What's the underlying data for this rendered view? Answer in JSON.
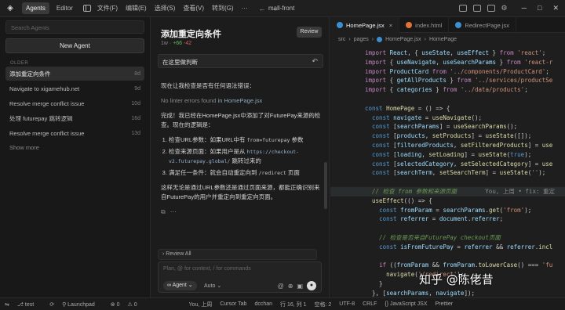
{
  "titlebar": {
    "tabs": [
      "Agents",
      "Editor"
    ],
    "menus": [
      "文件(F)",
      "编辑(E)",
      "选择(S)",
      "查看(V)",
      "转到(G)"
    ],
    "title": "mall-front"
  },
  "sidebar": {
    "search_placeholder": "Search Agents",
    "new_agent_label": "New Agent",
    "section_label": "OLDER",
    "items": [
      {
        "label": "添加重定向条件",
        "age": "8d"
      },
      {
        "label": "Navigate to xigamehub.net",
        "age": "9d"
      },
      {
        "label": "Resolve merge conflict issue",
        "age": "10d"
      },
      {
        "label": "处理 futurepay 跳转逻辑",
        "age": "16d"
      },
      {
        "label": "Resolve merge conflict issue",
        "age": "13d"
      }
    ],
    "show_more_label": "Show more"
  },
  "chat": {
    "title": "添加重定向条件",
    "meta_time": "1w",
    "meta_added": "+66",
    "meta_removed": "-42",
    "review_label": "Review",
    "prompt": "在这里做判断",
    "body": {
      "check_line": "现在让我检查是否有任何语法错误：",
      "lint_prefix": "No linter errors found",
      "lint_in": "in HomePage.jsx",
      "summary_a": "完成！我已经在HomePage.jsx中添加了对FuturePay来源的检查。现在的逻辑是：",
      "step1_a": "检查URL参数：如果URL中有",
      "step1_code": "from=futurepay",
      "step1_b": "参数",
      "step2_a": "检查来源页面：如果用户是从",
      "step2_url": "https://checkout-v2.futurepay.global/",
      "step2_b": "跳转过来的",
      "step3_a": "满足任一条件：就会自动重定向到",
      "step3_code": "/redirect",
      "step3_b": "页面",
      "conclusion": "这样无论是通过URL参数还是通过页面来源，都能正确识别来自FuturePay的用户并重定向到重定向页面。"
    },
    "review_all_label": "Review All",
    "composer_placeholder": "Plan, @ for context, / for commands",
    "mode_label": "Agent",
    "model_label": "Auto"
  },
  "editor": {
    "tabs": [
      {
        "label": "HomePage.jsx",
        "color": "#3d8fd1",
        "active": true
      },
      {
        "label": "index.html",
        "color": "#e0733b",
        "active": false
      },
      {
        "label": "RedirectPage.jsx",
        "color": "#3d8fd1",
        "active": false
      }
    ],
    "breadcrumb": [
      "src",
      "pages",
      "HomePage.jsx",
      "HomePage"
    ],
    "blame": "You, 上周 • fix: 重定"
  },
  "watermark": "知乎 @陈佬昔",
  "statusbar": {
    "branch": "test",
    "sync": "⟳",
    "launchpad": "Launchpad",
    "errors": "⊗ 0",
    "warnings": "⚠ 0",
    "author": "You, 上周",
    "cursor_tab": "Cursor Tab",
    "user": "dcchan",
    "position": "行 16, 列 1",
    "spaces": "空格: 2",
    "encoding": "UTF-8",
    "eol": "CRLF",
    "language": "{} JavaScript JSX",
    "prettier": "Prettier"
  }
}
